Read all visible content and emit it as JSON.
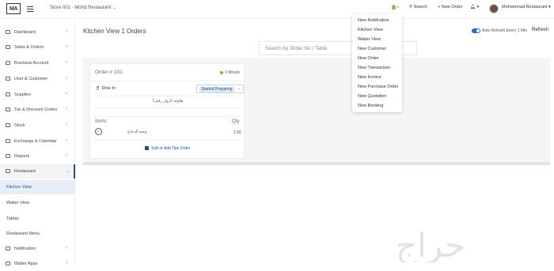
{
  "header": {
    "logo": "MA",
    "store_label": "Store 001 - Mohd Restaurant",
    "search_label": "Search",
    "new_order_label": "+ New Order",
    "user_name": "Mohammad Restaurant"
  },
  "sidebar": {
    "items": [
      {
        "label": "Dashboard"
      },
      {
        "label": "Sales & Orders"
      },
      {
        "label": "Business Account"
      },
      {
        "label": "User & Customer"
      },
      {
        "label": "Supplies"
      },
      {
        "label": "Tax & Discount Codes"
      },
      {
        "label": "Stock"
      },
      {
        "label": "Exchange & Calendar"
      },
      {
        "label": "Reports"
      },
      {
        "label": "Restaurant"
      }
    ],
    "subitems": [
      {
        "label": "Kitchen View"
      },
      {
        "label": "Waiter View"
      },
      {
        "label": "Tables"
      },
      {
        "label": "Restaurant Menu"
      }
    ],
    "bottom_items": [
      {
        "label": "Notification"
      },
      {
        "label": "Waiter Apps"
      }
    ]
  },
  "main": {
    "title": "Kitchen View 1 Orders",
    "auto_refresh_label": "Auto Refresh Every 1 Min",
    "refresh_label": "Refresh",
    "search_placeholder": "Search by Order No / Table"
  },
  "order": {
    "number": "Order # 101",
    "time": "1 Minute",
    "type": "Dine In",
    "status": "Started Preparing",
    "note": "طاولة الزوار رقم 1",
    "items_header": "Items",
    "qty_header": "Qty",
    "items": [
      {
        "name": "وجبة الدجاج",
        "qty": "1.00"
      }
    ],
    "edit_label": "Edit or Add Tips Order"
  },
  "dropdown": {
    "items": [
      {
        "label": "New Notification"
      },
      {
        "label": "Kitchen View"
      },
      {
        "label": "Waiter View"
      },
      {
        "label": "New Customer"
      },
      {
        "label": "New Order"
      },
      {
        "label": "New Transaction"
      },
      {
        "label": "New Invoice"
      },
      {
        "label": "New Purchase Order"
      },
      {
        "label": "New Quotation"
      },
      {
        "label": "New Booking"
      }
    ]
  },
  "watermark": "حراج",
  "colors": {
    "accent": "#1e6fd9",
    "status_bg": "#dbe8f8",
    "active_sidebar": "#1f4e9a",
    "online_dot": "#7cb342",
    "lightbulb": "#8bc34a"
  }
}
